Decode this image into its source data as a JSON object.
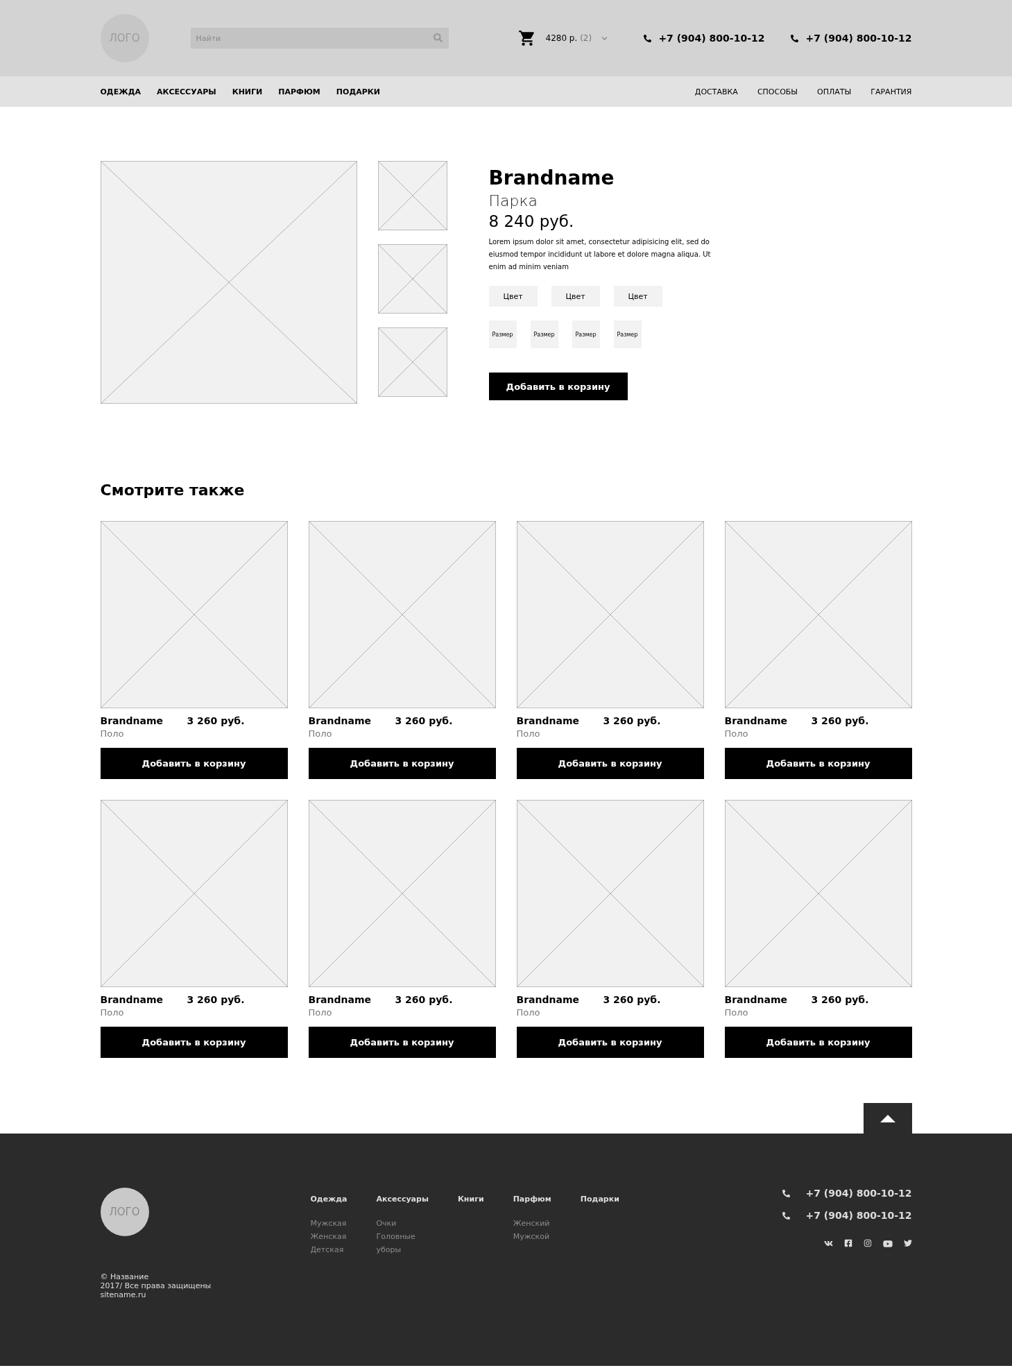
{
  "header": {
    "logo": "ЛОГО",
    "search": {
      "placeholder": "Найти"
    },
    "cart": {
      "total": "4280 р.",
      "count": "(2)"
    },
    "phones": [
      "+7 (904) 800-10-12",
      "+7 (904) 800-10-12"
    ]
  },
  "nav": {
    "categories": [
      "ОДЕЖДА",
      "АКСЕССУАРЫ",
      "КНИГИ",
      "ПАРФЮМ",
      "ПОДАРКИ"
    ],
    "info_links": [
      "ДОСТАВКА",
      "СПОСОБЫ",
      "ОПЛАТЫ",
      "ГАРАНТИЯ"
    ]
  },
  "product": {
    "brand": "Brandname",
    "name": "Парка",
    "price": "8 240 руб.",
    "description": "Lorem ipsum dolor sit amet, consectetur adipisicing elit, sed do eiusmod tempor incididunt ut labore et dolore magna aliqua. Ut enim ad minim veniam",
    "colors": [
      "Цвет",
      "Цвет",
      "Цвет"
    ],
    "sizes": [
      "Размер",
      "Размер",
      "Размер",
      "Размер"
    ],
    "add_button": "Добавить в корзину"
  },
  "related": {
    "title": "Смотрите также",
    "items": [
      {
        "brand": "Brandname",
        "price": "3 260 руб.",
        "name": "Поло",
        "button": "Добавить в корзину"
      },
      {
        "brand": "Brandname",
        "price": "3 260 руб.",
        "name": "Поло",
        "button": "Добавить в корзину"
      },
      {
        "brand": "Brandname",
        "price": "3 260 руб.",
        "name": "Поло",
        "button": "Добавить в корзину"
      },
      {
        "brand": "Brandname",
        "price": "3 260 руб.",
        "name": "Поло",
        "button": "Добавить в корзину"
      },
      {
        "brand": "Brandname",
        "price": "3 260 руб.",
        "name": "Поло",
        "button": "Добавить в корзину"
      },
      {
        "brand": "Brandname",
        "price": "3 260 руб.",
        "name": "Поло",
        "button": "Добавить в корзину"
      },
      {
        "brand": "Brandname",
        "price": "3 260 руб.",
        "name": "Поло",
        "button": "Добавить в корзину"
      },
      {
        "brand": "Brandname",
        "price": "3 260 руб.",
        "name": "Поло",
        "button": "Добавить в корзину"
      }
    ]
  },
  "footer": {
    "logo": "ЛОГО",
    "columns": [
      {
        "title": "Одежда",
        "links": [
          "Мужская",
          "Женская",
          "Детская"
        ]
      },
      {
        "title": "Аксессуары",
        "links": [
          "Очки",
          "Головные",
          "уборы"
        ]
      },
      {
        "title": "Книги"
      },
      {
        "title": "Парфюм",
        "links": [
          "Женский",
          "Мужской"
        ]
      },
      {
        "title": "Подарки"
      }
    ],
    "phones": [
      "+7 (904) 800-10-12",
      "+7 (904) 800-10-12"
    ],
    "copyright": [
      "© Название",
      "2017/ Все права защищены",
      "sitename.ru"
    ]
  }
}
